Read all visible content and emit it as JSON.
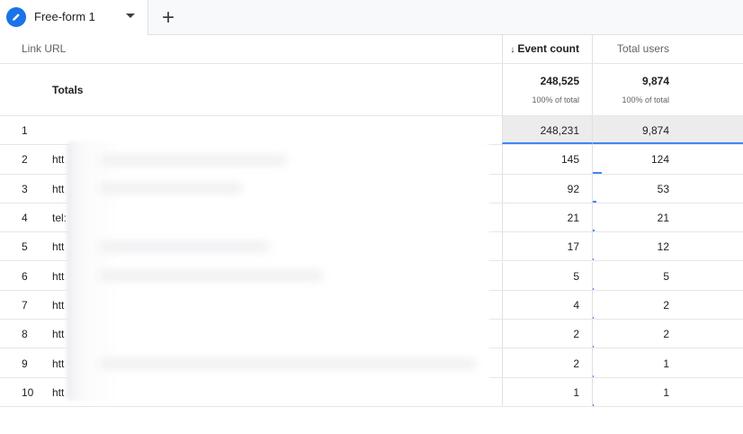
{
  "tab": {
    "label": "Free-form 1"
  },
  "columns": {
    "dimension": "Link URL",
    "event_count": "Event count",
    "total_users": "Total users"
  },
  "totals": {
    "label": "Totals",
    "event_count": "248,525",
    "event_count_pct": "100% of total",
    "total_users": "9,874",
    "total_users_pct": "100% of total"
  },
  "rows": [
    {
      "index": "1",
      "url": "",
      "event_count": "248,231",
      "total_users": "9,874",
      "ev_share": 1.0,
      "tu_share": 1.0
    },
    {
      "index": "2",
      "url": "htt",
      "event_count": "145",
      "total_users": "124",
      "ev_share": 0.0006,
      "tu_share": 0.0126
    },
    {
      "index": "3",
      "url": "htt",
      "event_count": "92",
      "total_users": "53",
      "ev_share": 0.0004,
      "tu_share": 0.0054
    },
    {
      "index": "4",
      "url": "tel:",
      "event_count": "21",
      "total_users": "21",
      "ev_share": 0.0001,
      "tu_share": 0.0021
    },
    {
      "index": "5",
      "url": "htt",
      "event_count": "17",
      "total_users": "12",
      "ev_share": 0.0001,
      "tu_share": 0.0012
    },
    {
      "index": "6",
      "url": "htt",
      "event_count": "5",
      "total_users": "5",
      "ev_share": 0.0,
      "tu_share": 0.0005
    },
    {
      "index": "7",
      "url": "htt",
      "event_count": "4",
      "total_users": "2",
      "ev_share": 0.0,
      "tu_share": 0.0002
    },
    {
      "index": "8",
      "url": "htt",
      "event_count": "2",
      "total_users": "2",
      "ev_share": 0.0,
      "tu_share": 0.0002
    },
    {
      "index": "9",
      "url": "htt",
      "event_count": "2",
      "total_users": "1",
      "ev_share": 0.0,
      "tu_share": 0.0001
    },
    {
      "index": "10",
      "url": "htt",
      "event_count": "1",
      "total_users": "1",
      "ev_share": 0.0,
      "tu_share": 0.0001
    }
  ],
  "colors": {
    "accent": "#1a73e8",
    "bar": "#4285f4"
  }
}
